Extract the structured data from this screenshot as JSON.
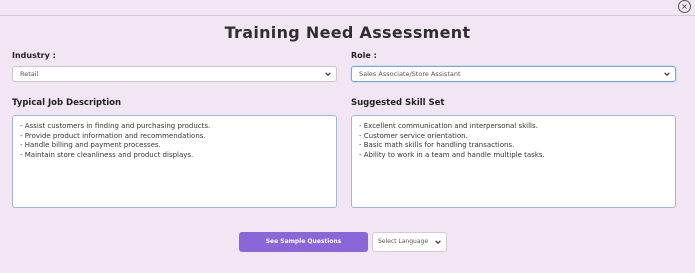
{
  "header": {
    "close_symbol": "×"
  },
  "title": "Training Need Assessment",
  "industry": {
    "label": "Industry :",
    "value": "Retail"
  },
  "role": {
    "label": "Role :",
    "value": "Sales Associate/Store Assistant"
  },
  "job_description": {
    "title": "Typical Job Description",
    "lines": [
      "- Assist customers in finding and purchasing products.",
      "- Provide product information and recommendations.",
      "- Handle billing and payment processes.",
      "- Maintain store cleanliness and product displays."
    ]
  },
  "skill_set": {
    "title": "Suggested Skill Set",
    "lines": [
      "- Excellent communication and interpersonal skills.",
      "- Customer service orientation.",
      "- Basic math skills for handling transactions.",
      "- Ability to work in a team and handle multiple tasks."
    ]
  },
  "actions": {
    "sample_questions_label": "See Sample Questions",
    "language_placeholder": "Select Language"
  },
  "colors": {
    "accent": "#8a66d9",
    "background": "#f3e6f4"
  }
}
